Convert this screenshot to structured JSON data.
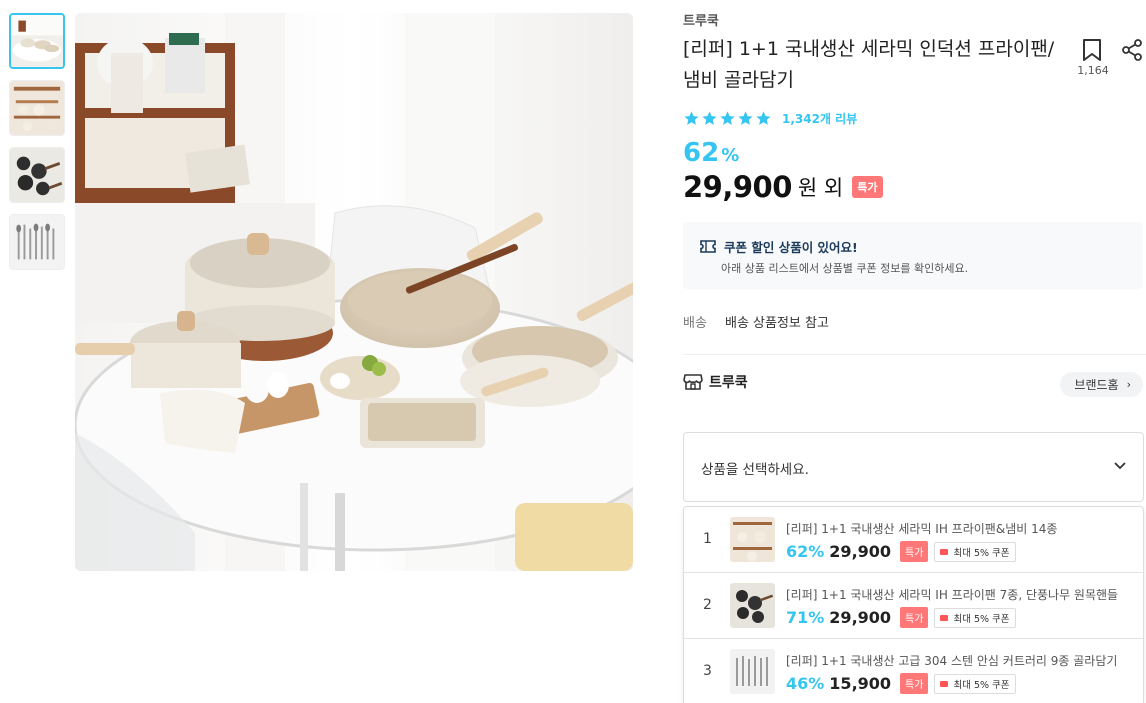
{
  "product": {
    "brand": "트루쿡",
    "title": "[리퍼] 1+1 국내생산 세라믹 인덕션 프라이팬/냄비 골라담기",
    "scrap_count": "1,164",
    "review_count": "1,342개 리뷰",
    "rating_stars": 5,
    "discount_value": "62",
    "discount_unit": "%",
    "price": "29,900",
    "price_suffix": "원 외",
    "special_badge": "특가"
  },
  "coupon": {
    "title": "쿠폰 할인 상품이 있어요!",
    "description": "아래 상품 리스트에서 상품별 쿠폰 정보를 확인하세요."
  },
  "shipping": {
    "label": "배송",
    "value": "배송 상품정보 참고"
  },
  "store": {
    "name": "트루쿡",
    "brand_home_label": "브랜드홈"
  },
  "selector": {
    "placeholder": "상품을 선택하세요."
  },
  "options": [
    {
      "num": "1",
      "name": "[리퍼] 1+1 국내생산 세라믹 IH 프라이팬&냄비 14종",
      "discount": "62%",
      "price": "29,900",
      "special": "특가",
      "coupon": "최대 5% 쿠폰"
    },
    {
      "num": "2",
      "name": "[리퍼] 1+1 국내생산 세라믹 IH 프라이팬 7종, 단풍나무 원목핸들",
      "discount": "71%",
      "price": "29,900",
      "special": "특가",
      "coupon": "최대 5% 쿠폰"
    },
    {
      "num": "3",
      "name": "[리퍼] 1+1 국내생산 고급 304 스텐 안심 커트러리 9종 골라담기",
      "discount": "46%",
      "price": "15,900",
      "special": "특가",
      "coupon": "최대 5% 쿠폰"
    }
  ],
  "colors": {
    "accent": "#35c5f0",
    "special": "#ff7777",
    "coupon_bg": "#f7f9fa"
  }
}
